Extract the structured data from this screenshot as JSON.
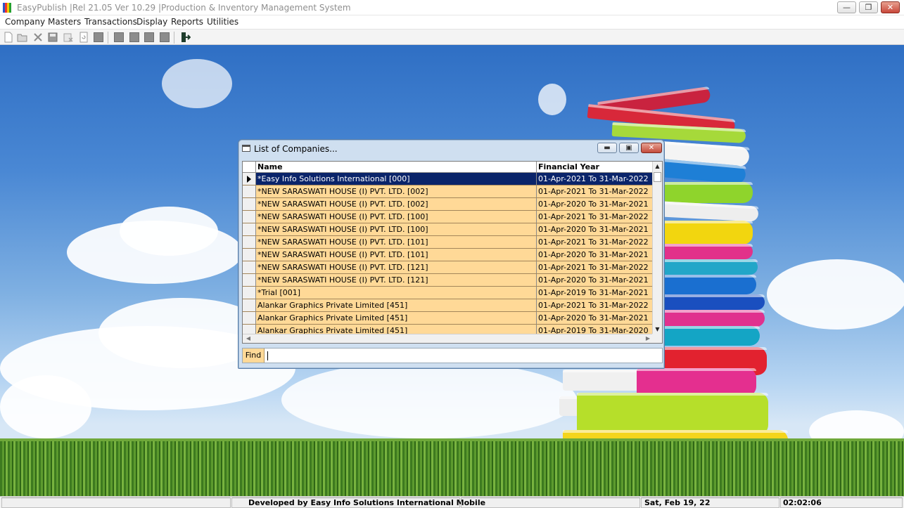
{
  "window": {
    "title": "EasyPublish |Rel 21.05 Ver 10.29 |Production & Inventory Management System",
    "controls": {
      "minimize": "—",
      "restore": "❐",
      "close": "✕"
    }
  },
  "menu": [
    "Company",
    "Masters",
    "Transactions",
    "Display",
    "Reports",
    "Utilities"
  ],
  "toolbar_icons": [
    "new-icon",
    "open-icon",
    "delete-icon",
    "save-icon",
    "cancel-icon",
    "refresh-icon",
    "print-icon",
    "first-icon",
    "previous-icon",
    "next-icon",
    "last-icon",
    "exit-icon"
  ],
  "dialog": {
    "title": "List of Companies...",
    "controls": {
      "minimize": "▬",
      "restore": "▣",
      "close": "✕"
    },
    "columns": {
      "name": "Name",
      "year": "Financial Year"
    },
    "rows": [
      {
        "name": "*Easy Info Solutions International [000]",
        "year": "01-Apr-2021 To 31-Mar-2022"
      },
      {
        "name": "*NEW SARASWATI HOUSE (I) PVT. LTD. [002]",
        "year": "01-Apr-2021 To 31-Mar-2022"
      },
      {
        "name": "*NEW SARASWATI HOUSE (I) PVT. LTD. [002]",
        "year": "01-Apr-2020 To 31-Mar-2021"
      },
      {
        "name": "*NEW SARASWATI HOUSE (I) PVT. LTD. [100]",
        "year": "01-Apr-2021 To 31-Mar-2022"
      },
      {
        "name": "*NEW SARASWATI HOUSE (I) PVT. LTD. [100]",
        "year": "01-Apr-2020 To 31-Mar-2021"
      },
      {
        "name": "*NEW SARASWATI HOUSE (I) PVT. LTD. [101]",
        "year": "01-Apr-2021 To 31-Mar-2022"
      },
      {
        "name": "*NEW SARASWATI HOUSE (I) PVT. LTD. [101]",
        "year": "01-Apr-2020 To 31-Mar-2021"
      },
      {
        "name": "*NEW SARASWATI HOUSE (I) PVT. LTD. [121]",
        "year": "01-Apr-2021 To 31-Mar-2022"
      },
      {
        "name": "*NEW SARASWATI HOUSE (I) PVT. LTD. [121]",
        "year": "01-Apr-2020 To 31-Mar-2021"
      },
      {
        "name": "*Trial [001]",
        "year": "01-Apr-2019 To 31-Mar-2021"
      },
      {
        "name": "Alankar Graphics Private Limited [451]",
        "year": "01-Apr-2021 To 31-Mar-2022"
      },
      {
        "name": "Alankar Graphics Private Limited [451]",
        "year": "01-Apr-2020 To 31-Mar-2021"
      },
      {
        "name": "Alankar Graphics Private Limited [451]",
        "year": "01-Apr-2019 To 31-Mar-2020"
      }
    ],
    "selected_row": 0,
    "find_label": "Find",
    "find_value": ""
  },
  "statusbar": {
    "developer": "Developed by Easy Info Solutions International Mobile",
    "date": "Sat, Feb 19, 22",
    "time": "02:02:06"
  },
  "colors": {
    "row_bg": "#ffd997",
    "selected_row_bg": "#0a246a",
    "dialog_frame": "#cfdff0",
    "sky": "#4a88d4",
    "grass": "#5c9a2e"
  }
}
